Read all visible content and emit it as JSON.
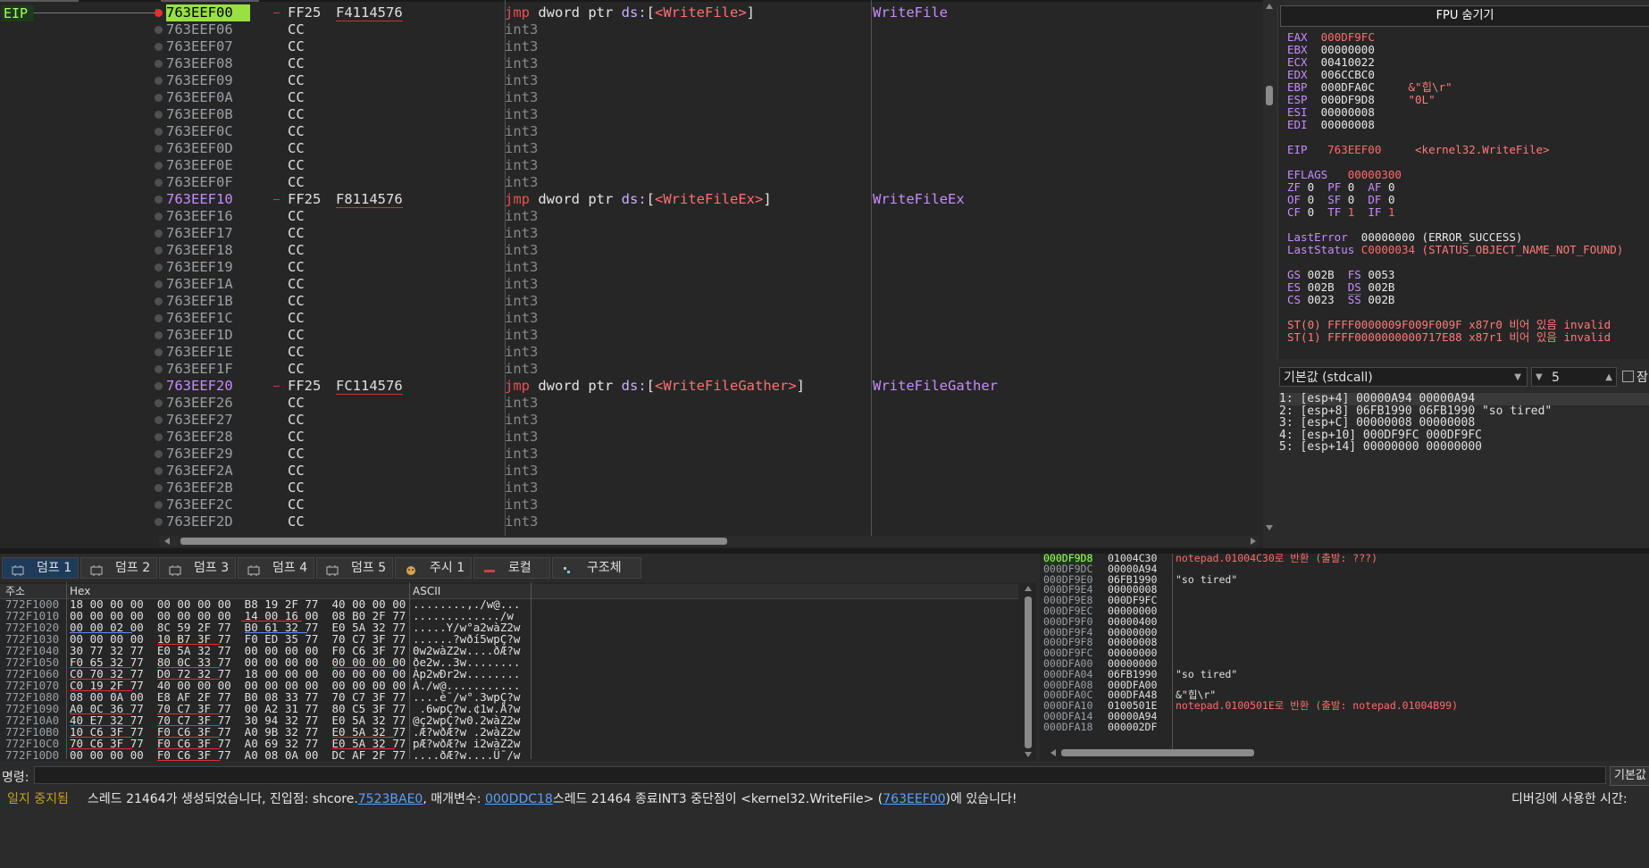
{
  "disasm": {
    "eip_label": "EIP",
    "rows": [
      {
        "addr": "763EEF00",
        "label": true,
        "eip": true,
        "bp": true,
        "bytes": "FF25",
        "bytes2": "F4114576",
        "kind": "jmp",
        "target": "WriteFile",
        "comment": "WriteFile"
      },
      {
        "addr": "763EEF06",
        "bytes": "CC",
        "ins": "int3"
      },
      {
        "addr": "763EEF07",
        "bytes": "CC",
        "ins": "int3"
      },
      {
        "addr": "763EEF08",
        "bytes": "CC",
        "ins": "int3"
      },
      {
        "addr": "763EEF09",
        "bytes": "CC",
        "ins": "int3"
      },
      {
        "addr": "763EEF0A",
        "bytes": "CC",
        "ins": "int3"
      },
      {
        "addr": "763EEF0B",
        "bytes": "CC",
        "ins": "int3"
      },
      {
        "addr": "763EEF0C",
        "bytes": "CC",
        "ins": "int3"
      },
      {
        "addr": "763EEF0D",
        "bytes": "CC",
        "ins": "int3"
      },
      {
        "addr": "763EEF0E",
        "bytes": "CC",
        "ins": "int3"
      },
      {
        "addr": "763EEF0F",
        "bytes": "CC",
        "ins": "int3"
      },
      {
        "addr": "763EEF10",
        "label": true,
        "bytes": "FF25",
        "bytes2": "F8114576",
        "kind": "jmp",
        "target": "WriteFileEx",
        "comment": "WriteFileEx"
      },
      {
        "addr": "763EEF16",
        "bytes": "CC",
        "ins": "int3"
      },
      {
        "addr": "763EEF17",
        "bytes": "CC",
        "ins": "int3"
      },
      {
        "addr": "763EEF18",
        "bytes": "CC",
        "ins": "int3"
      },
      {
        "addr": "763EEF19",
        "bytes": "CC",
        "ins": "int3"
      },
      {
        "addr": "763EEF1A",
        "bytes": "CC",
        "ins": "int3"
      },
      {
        "addr": "763EEF1B",
        "bytes": "CC",
        "ins": "int3"
      },
      {
        "addr": "763EEF1C",
        "bytes": "CC",
        "ins": "int3"
      },
      {
        "addr": "763EEF1D",
        "bytes": "CC",
        "ins": "int3"
      },
      {
        "addr": "763EEF1E",
        "bytes": "CC",
        "ins": "int3"
      },
      {
        "addr": "763EEF1F",
        "bytes": "CC",
        "ins": "int3"
      },
      {
        "addr": "763EEF20",
        "label": true,
        "bytes": "FF25",
        "bytes2": "FC114576",
        "kind": "jmp",
        "target": "WriteFileGather",
        "comment": "WriteFileGather"
      },
      {
        "addr": "763EEF26",
        "bytes": "CC",
        "ins": "int3"
      },
      {
        "addr": "763EEF27",
        "bytes": "CC",
        "ins": "int3"
      },
      {
        "addr": "763EEF28",
        "bytes": "CC",
        "ins": "int3"
      },
      {
        "addr": "763EEF29",
        "bytes": "CC",
        "ins": "int3"
      },
      {
        "addr": "763EEF2A",
        "bytes": "CC",
        "ins": "int3"
      },
      {
        "addr": "763EEF2B",
        "bytes": "CC",
        "ins": "int3"
      },
      {
        "addr": "763EEF2C",
        "bytes": "CC",
        "ins": "int3"
      },
      {
        "addr": "763EEF2D",
        "bytes": "CC",
        "ins": "int3"
      }
    ],
    "jmp_parts": {
      "kw": "jmp",
      "size": "dword ptr ",
      "seg": "ds:",
      "open": "[",
      "close": "]"
    }
  },
  "registers": {
    "fpu_button": "FPU 숨기기",
    "general": [
      {
        "name": "EAX",
        "value": "000DF9FC",
        "changed": true,
        "comment": ""
      },
      {
        "name": "EBX",
        "value": "00000000",
        "comment": ""
      },
      {
        "name": "ECX",
        "value": "00410022",
        "comment": ""
      },
      {
        "name": "EDX",
        "value": "006CCBC0",
        "comment": ""
      },
      {
        "name": "EBP",
        "value": "000DFA0C",
        "comment": "&\"힙\\r\""
      },
      {
        "name": "ESP",
        "value": "000DF9D8",
        "comment": "\"0L\""
      },
      {
        "name": "ESI",
        "value": "00000008",
        "comment": ""
      },
      {
        "name": "EDI",
        "value": "00000008",
        "comment": ""
      }
    ],
    "eip": {
      "name": "EIP",
      "value": "763EEF00",
      "comment": "<kernel32.WriteFile>"
    },
    "eflags": {
      "name": "EFLAGS",
      "value": "00000300"
    },
    "flags": [
      [
        {
          "n": "ZF",
          "v": "0"
        },
        {
          "n": "PF",
          "v": "0"
        },
        {
          "n": "AF",
          "v": "0"
        }
      ],
      [
        {
          "n": "OF",
          "v": "0"
        },
        {
          "n": "SF",
          "v": "0"
        },
        {
          "n": "DF",
          "v": "0"
        }
      ],
      [
        {
          "n": "CF",
          "v": "0"
        },
        {
          "n": "TF",
          "v": "1"
        },
        {
          "n": "IF",
          "v": "1"
        }
      ]
    ],
    "last_error": {
      "name": "LastError",
      "value": "00000000",
      "desc": "(ERROR_SUCCESS)"
    },
    "last_status": {
      "name": "LastStatus",
      "value": "C0000034",
      "desc": "(STATUS_OBJECT_NAME_NOT_FOUND)"
    },
    "segments": [
      [
        {
          "n": "GS",
          "v": "002B"
        },
        {
          "n": "FS",
          "v": "0053"
        }
      ],
      [
        {
          "n": "ES",
          "v": "002B"
        },
        {
          "n": "DS",
          "v": "002B"
        }
      ],
      [
        {
          "n": "CS",
          "v": "0023"
        },
        {
          "n": "SS",
          "v": "002B"
        }
      ]
    ],
    "fpu": [
      {
        "name": "ST(0)",
        "value": "FFFF0000009F009F009F",
        "tag": "x87r0",
        "desc": "비어 있음 invalid"
      },
      {
        "name": "ST(1)",
        "value": "FFFF0000000000717E88",
        "tag": "x87r1",
        "desc": "비어 있음 invalid"
      }
    ]
  },
  "args": {
    "calling_convention": "기본값 (stdcall)",
    "count": "5",
    "rows": [
      "1: [esp+4] 00000A94 00000A94",
      "2: [esp+8] 06FB1990 06FB1990 \"so tired\"",
      "3: [esp+C] 00000008 00000008",
      "4: [esp+10] 000DF9FC 000DF9FC",
      "5: [esp+14] 00000000 00000000"
    ]
  },
  "dump_tabs": [
    {
      "label": "덤프 1",
      "active": true
    },
    {
      "label": "덤프 2"
    },
    {
      "label": "덤프 3"
    },
    {
      "label": "덤프 4"
    },
    {
      "label": "덤프 5"
    },
    {
      "label": "주시 1"
    },
    {
      "label": "로컬"
    },
    {
      "label": "구조체"
    }
  ],
  "dump": {
    "headers": {
      "addr": "주소",
      "hex": "Hex",
      "ascii": "ASCII"
    },
    "rows": [
      {
        "a": "772F1000",
        "h": "18 00 00 00  00 00 00 00  B8 19 2F 77  40 00 00 00",
        "s": "........,./w@..."
      },
      {
        "a": "772F1010",
        "h": "00 00 00 00  00 00 00 00  14 00 16 00  08 B0 2F 77",
        "s": "............./w"
      },
      {
        "a": "772F1020",
        "h": "00 00 02 00  8C 59 2F 77  B0 61 32 77  E0 5A 32 77",
        "s": ".....Y/w°a2wàZ2w"
      },
      {
        "a": "772F1030",
        "h": "00 00 00 00  10 B7 3F 77  F0 ED 35 77  70 C7 3F 77",
        "s": "......?wðí5wpÇ?w"
      },
      {
        "a": "772F1040",
        "h": "30 77 32 77  E0 5A 32 77  00 00 00 00  F0 C6 3F 77",
        "s": "0w2wàZ2w....ðÆ?w"
      },
      {
        "a": "772F1050",
        "h": "F0 65 32 77  80 0C 33 77  00 00 00 00  00 00 00 00",
        "s": "ðe2w..3w........"
      },
      {
        "a": "772F1060",
        "h": "C0 70 32 77  D0 72 32 77  18 00 00 00  00 00 00 00",
        "s": "Àp2wÐr2w........"
      },
      {
        "a": "772F1070",
        "h": "C0 19 2F 77  40 00 00 00  00 00 00 00  00 00 00 00",
        "s": "À./w@..........."
      },
      {
        "a": "772F1080",
        "h": "08 00 0A 00  E8 AF 2F 77  B0 08 33 77  70 C7 3F 77",
        "s": "....è¯/w°.3wpÇ?w"
      },
      {
        "a": "772F1090",
        "h": "A0 0C 36 77  70 C7 3F 77  00 A2 31 77  80 C5 3F 77",
        "s": " .6wpÇ?w.¢1w.Å?w"
      },
      {
        "a": "772F10A0",
        "h": "40 E7 32 77  70 C7 3F 77  30 94 32 77  E0 5A 32 77",
        "s": "@ç2wpÇ?w0.2wàZ2w"
      },
      {
        "a": "772F10B0",
        "h": "10 C6 3F 77  F0 C6 3F 77  A0 9B 32 77  E0 5A 32 77",
        "s": ".Æ?wðÆ?w .2wàZ2w"
      },
      {
        "a": "772F10C0",
        "h": "70 C6 3F 77  F0 C6 3F 77  A0 69 32 77  E0 5A 32 77",
        "s": "pÆ?wðÆ?w i2wàZ2w"
      },
      {
        "a": "772F10D0",
        "h": "00 00 00 00  F0 C6 3F 77  A0 08 0A 00  DC AF 2F 77",
        "s": "....ðÆ?w....Ü¯/w"
      }
    ]
  },
  "stack": {
    "rows": [
      {
        "a": "000DF9D8",
        "v": "01004C30",
        "c": "notepad.01004C30로 반환 (출발: ???)",
        "ret": true,
        "top": true
      },
      {
        "a": "000DF9DC",
        "v": "00000A94",
        "c": ""
      },
      {
        "a": "000DF9E0",
        "v": "06FB1990",
        "c": "\"so tired\""
      },
      {
        "a": "000DF9E4",
        "v": "00000008",
        "c": ""
      },
      {
        "a": "000DF9E8",
        "v": "000DF9FC",
        "c": ""
      },
      {
        "a": "000DF9EC",
        "v": "00000000",
        "c": ""
      },
      {
        "a": "000DF9F0",
        "v": "00000400",
        "c": ""
      },
      {
        "a": "000DF9F4",
        "v": "00000000",
        "c": ""
      },
      {
        "a": "000DF9F8",
        "v": "00000008",
        "c": ""
      },
      {
        "a": "000DF9FC",
        "v": "00000000",
        "c": ""
      },
      {
        "a": "000DFA00",
        "v": "00000000",
        "c": ""
      },
      {
        "a": "000DFA04",
        "v": "06FB1990",
        "c": "\"so tired\""
      },
      {
        "a": "000DFA08",
        "v": "000DFA00",
        "c": ""
      },
      {
        "a": "000DFA0C",
        "v": "000DFA48",
        "c": "&\"힙\\r\""
      },
      {
        "a": "000DFA10",
        "v": "0100501E",
        "c": "notepad.0100501E로 반환 (출발: notepad.01004B99)",
        "ret": true
      },
      {
        "a": "000DFA14",
        "v": "00000A94",
        "c": ""
      },
      {
        "a": "000DFA18",
        "v": "000002DF",
        "c": ""
      }
    ]
  },
  "command": {
    "label": "명령:",
    "button": "기본값"
  },
  "status": {
    "state": "일지 중지됨",
    "msg_1": "스레드 21464가 생성되었습니다, 진입점: shcore.",
    "link_1": "7523BAE0",
    "msg_2": ", 매개변수: ",
    "link_2": "000DDC18",
    "msg_3": "스레드 21464 종료INT3 중단점이 <kernel32.WriteFile> (",
    "link_3": "763EEF00",
    "msg_4": ")에 있습니다!",
    "time": "디버깅에 사용한 시간:"
  },
  "colors": {
    "eip_highlight": "#99e040",
    "breakpoint": "#e03030",
    "label": "#c78cff",
    "changed": "#ff6b6b"
  }
}
